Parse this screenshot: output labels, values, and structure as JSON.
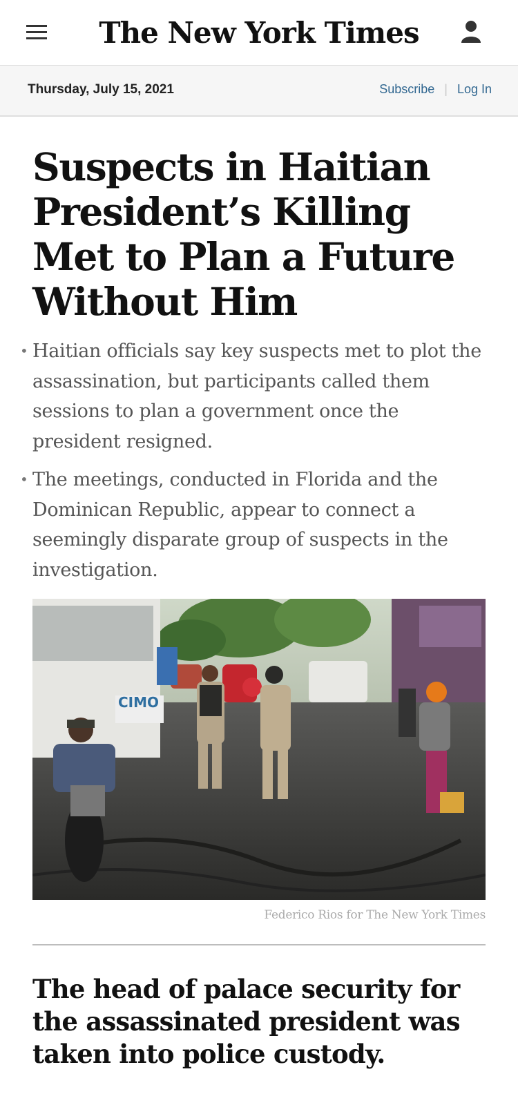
{
  "header": {
    "logo_text": "The New York Times",
    "menu_icon": "hamburger-menu-icon",
    "account_icon": "user-icon"
  },
  "datebar": {
    "date": "Thursday, July 15, 2021",
    "subscribe_label": "Subscribe",
    "separator": "|",
    "login_label": "Log In",
    "link_color": "#326891"
  },
  "article": {
    "headline": "Suspects in Haitian President’s Killing Met to Plan a Future Without Him",
    "summary": [
      "Haitian officials say key suspects met to plot the assassination, but participants called them sessions to plan a government once the president resigned.",
      "The meetings, conducted in Florida and the Dominican Republic, appear to connect a seemingly disparate group of suspects in the investigation."
    ],
    "bullet": "•",
    "photo_credit": "Federico Rios for The New York Times",
    "photo_sign_text": "CIMO",
    "subhead": "The head of palace security for the assassinated president was taken into police custody."
  }
}
